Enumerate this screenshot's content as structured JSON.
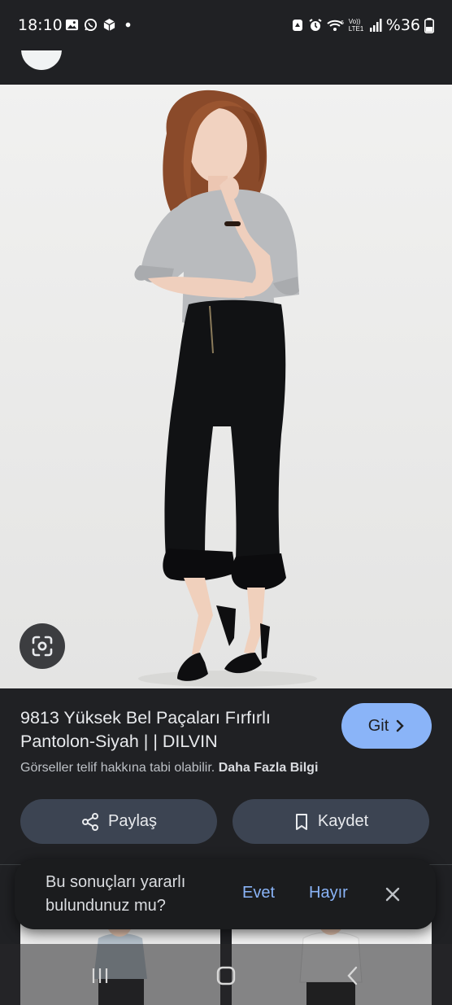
{
  "status_bar": {
    "time": "18:10",
    "battery": "%36",
    "left_icons": [
      "gallery-icon",
      "whatsapp-icon",
      "box-icon",
      "dot-icon"
    ],
    "right_icons": [
      "recycle-icon",
      "alarm-icon",
      "wifi-icon",
      "volte-icon",
      "signal-icon",
      "battery-icon"
    ],
    "volte_text": "Vo)) LTE1"
  },
  "result": {
    "title": "9813 Yüksek Bel Paçaları Fırfırlı Pantolon-Siyah | | DILVIN",
    "visit_label": "Git",
    "copyright_text": "Görseller telif hakkına tabi olabilir.",
    "more_info_label": "Daha Fazla Bilgi",
    "share_label": "Paylaş",
    "save_label": "Kaydet"
  },
  "feedback": {
    "question": "Bu sonuçları yararlı bulundunuz mu?",
    "yes_label": "Evet",
    "no_label": "Hayır"
  },
  "colors": {
    "background": "#202124",
    "accent": "#8ab4f8",
    "action_button": "#3c4452"
  }
}
